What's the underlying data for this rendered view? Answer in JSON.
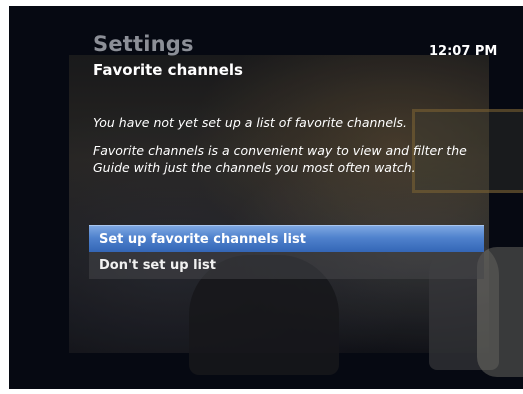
{
  "header": {
    "title": "Settings",
    "subtitle": "Favorite channels",
    "clock": "12:07 PM"
  },
  "body": {
    "message_1": "You have not yet set up a list of favorite channels.",
    "message_2": "Favorite channels is a convenient way to view and filter the Guide with just the channels you most often watch."
  },
  "menu": {
    "items": [
      {
        "label": "Set up favorite channels list",
        "focused": true
      },
      {
        "label": "Don't set up list",
        "focused": false
      }
    ]
  },
  "colors": {
    "focus_highlight": "#4f82cd",
    "title_gray": "#8c8f97",
    "screen_background": "#060912"
  }
}
